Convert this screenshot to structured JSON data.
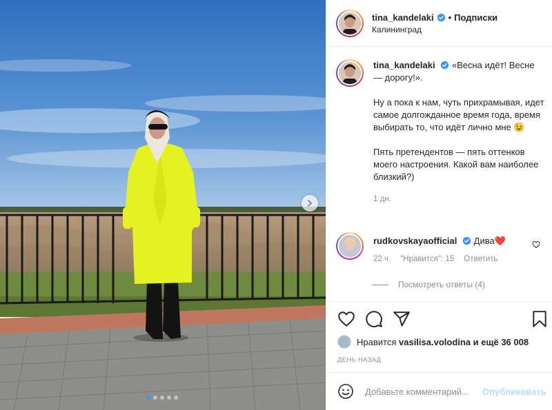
{
  "post": {
    "username": "tina_kandelaki",
    "follow_label": "Подписки",
    "separator": "•",
    "location": "Калининград",
    "caption_quote": "«Весна идёт! Весне — дорогу!».",
    "caption_para1": "Ну а пока к нам, чуть прихрамывая, идет самое долгожданное время года, время выбирать то, что идёт лично мне 😉",
    "caption_para2": "Пять претендентов — пять оттенков моего настроения. Какой вам наиболее близкий?)",
    "caption_time": "1 дн."
  },
  "comment": {
    "username": "rudkovskayaofficial",
    "text": "Дива❤️",
    "time": "22 ч.",
    "likes": "\"Нравится\": 15",
    "reply_label": "Ответить",
    "view_replies": "Посмотреть ответы (4)"
  },
  "likes": {
    "prefix": "Нравится",
    "user": "vasilisa.volodina",
    "suffix": "и ещё 36 008"
  },
  "ago": "ДЕНЬ НАЗАД",
  "add_comment": {
    "placeholder": "Добавьте комментарий...",
    "publish_label": "Опубликовать"
  },
  "colors": {
    "verified": "#3897f0",
    "coat": "#e5f222",
    "sky": "#3e7cc4",
    "heart": "#ed4956"
  },
  "icons": [
    "verified-icon",
    "chevron-right-icon",
    "heart-icon",
    "comment-icon",
    "share-icon",
    "bookmark-icon",
    "emoji-icon"
  ],
  "carousel": {
    "slides": 5,
    "current": 1
  }
}
